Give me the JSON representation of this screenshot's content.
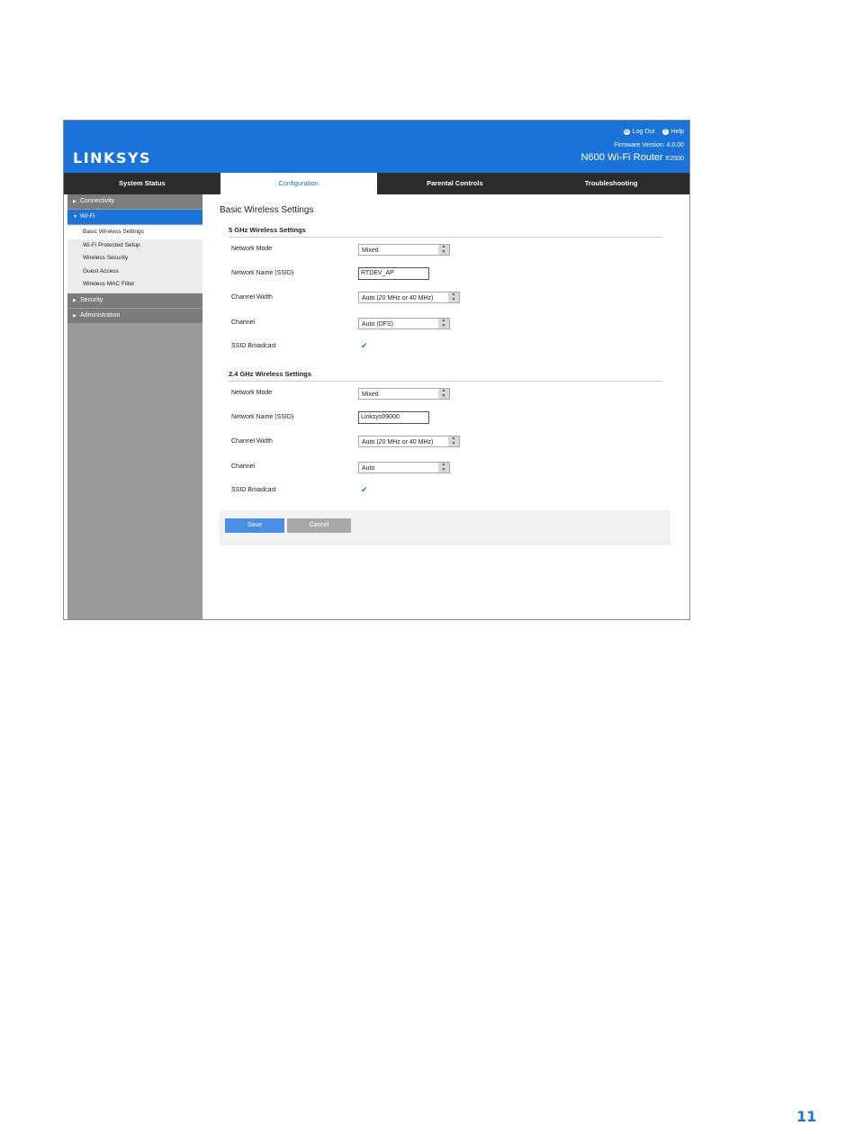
{
  "header": {
    "logo": "LINKSYS",
    "logout": "Log Out",
    "help": "Help",
    "firmware": "Firmware Version: 4.0.00",
    "model": "N600 Wi-Fi Router",
    "model_code": "E2500"
  },
  "nav": {
    "tabs": [
      "System Status",
      "Configuration",
      "Parental Controls",
      "Troubleshooting"
    ],
    "active": "Configuration"
  },
  "sidebar": {
    "sections": [
      {
        "label": "Connectivity"
      },
      {
        "label": "Wi-Fi",
        "active": true,
        "items": [
          "Basic Wireless Settings",
          "Wi-Fi Protected Setup",
          "Wireless Security",
          "Guest Access",
          "Wireless MAC Filter"
        ]
      },
      {
        "label": "Security"
      },
      {
        "label": "Administration"
      }
    ]
  },
  "content": {
    "title": "Basic Wireless Settings",
    "band5": {
      "heading": "5 GHz Wireless Settings",
      "network_mode_label": "Network Mode",
      "network_mode_value": "Mixed",
      "ssid_label": "Network Name (SSID)",
      "ssid_value": "RTDEV_AP",
      "channel_width_label": "Channel Width",
      "channel_width_value": "Auto (20 MHz or 40 MHz)",
      "channel_label": "Channel",
      "channel_value": "Auto (DFS)",
      "broadcast_label": "SSID Broadcast",
      "broadcast_checked": true
    },
    "band24": {
      "heading": "2.4 GHz Wireless Settings",
      "network_mode_label": "Network Mode",
      "network_mode_value": "Mixed",
      "ssid_label": "Network Name (SSID)",
      "ssid_value": "Linksys09000",
      "channel_width_label": "Channel Width",
      "channel_width_value": "Auto (20 MHz or 40 MHz)",
      "channel_label": "Channel",
      "channel_value": "Auto",
      "broadcast_label": "SSID Broadcast",
      "broadcast_checked": true
    },
    "save_label": "Save",
    "cancel_label": "Cancel"
  },
  "page_number": "11",
  "colors": {
    "brand": "#1a73d9",
    "nav_bg": "#2c2c2c",
    "sidebar_bg": "#9a9a9a"
  },
  "icons": {
    "logout": "logout-icon",
    "help": "help-icon",
    "check": "checkmark-icon"
  }
}
